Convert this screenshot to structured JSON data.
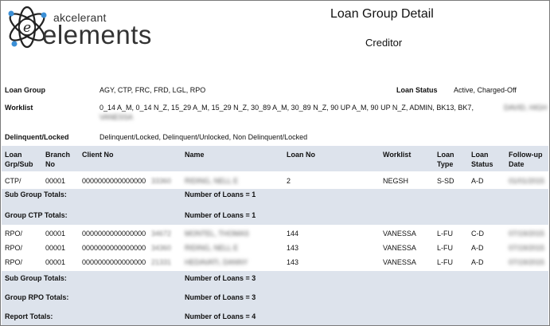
{
  "logo": {
    "brand_top": "akcelerant",
    "brand_bottom": "elements",
    "emblem_letter": "e"
  },
  "report": {
    "title": "Loan Group Detail",
    "subtitle": "Creditor"
  },
  "criteria": {
    "loan_group_label": "Loan Group",
    "loan_group_value": "AGY, CTP, FRC, FRD, LGL, RPO",
    "loan_status_label": "Loan Status",
    "loan_status_value": "Active, Charged-Off",
    "worklist_label": "Worklist",
    "worklist_value": "0_14 A_M, 0_14 N_Z, 15_29 A_M, 15_29 N_Z, 30_89 A_M, 30_89 N_Z, 90 UP A_M, 90 UP N_Z, ADMIN, BK13, BK7,",
    "worklist_redacted_1": "DAVID, HIGH",
    "worklist_redacted_2": "VANESSA",
    "delinquent_label": "Delinquent/Locked",
    "delinquent_value": "Delinquent/Locked, Delinquent/Unlocked, Non Delinquent/Locked"
  },
  "table": {
    "headers": {
      "loan_grp": "Loan Grp/Sub",
      "branch": "Branch No",
      "client": "Client No",
      "name": "Name",
      "loan_no": "Loan No",
      "worklist": "Worklist",
      "loan_type": "Loan Type",
      "loan_status": "Loan Status",
      "follow_up": "Follow-up Date"
    },
    "rows": [
      {
        "grp": "CTP/",
        "branch": "00001",
        "client": "0000000000000000",
        "client_redacted": "33360",
        "name": "RIDING, NELL E",
        "loan_no": "2",
        "worklist": "NEGSH",
        "type": "S-SD",
        "status": "A-D",
        "follow_up": "01/01/2015"
      },
      {
        "grp": "RPO/",
        "branch": "00001",
        "client": "0000000000000000",
        "client_redacted": "34672",
        "name": "MONTEL, THOMAS",
        "loan_no": "144",
        "worklist": "VANESSA",
        "type": "L-FU",
        "status": "C-D",
        "follow_up": "07/19/2015"
      },
      {
        "grp": "RPO/",
        "branch": "00001",
        "client": "0000000000000000",
        "client_redacted": "34360",
        "name": "RIDING, NELL E",
        "loan_no": "143",
        "worklist": "VANESSA",
        "type": "L-FU",
        "status": "A-D",
        "follow_up": "07/19/2015"
      },
      {
        "grp": "RPO/",
        "branch": "00001",
        "client": "0000000000000000",
        "client_redacted": "21331",
        "name": "HEDAVATI, DANNY",
        "loan_no": "143",
        "worklist": "VANESSA",
        "type": "L-FU",
        "status": "A-D",
        "follow_up": "07/19/2015"
      }
    ],
    "totals": {
      "sub_group_1_label": "Sub Group Totals:",
      "sub_group_1_value": "Number of Loans = 1",
      "group_ctp_label": "Group CTP Totals:",
      "group_ctp_value": "Number of Loans = 1",
      "sub_group_2_label": "Sub Group Totals:",
      "sub_group_2_value": "Number of Loans = 3",
      "group_rpo_label": "Group RPO Totals:",
      "group_rpo_value": "Number of Loans = 3",
      "report_label": "Report Totals:",
      "report_value": "Number of Loans = 4"
    }
  }
}
